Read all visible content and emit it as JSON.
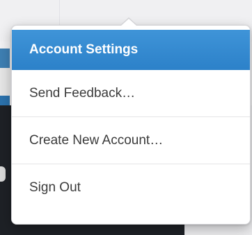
{
  "menu": {
    "items": [
      {
        "label": "Account Settings",
        "active": true
      },
      {
        "label": "Send Feedback…",
        "active": false
      },
      {
        "label": "Create New Account…",
        "active": false
      },
      {
        "label": "Sign Out",
        "active": false
      }
    ]
  },
  "colors": {
    "highlight": "#2f86cf",
    "popover_bg": "#ffffff",
    "text": "#3b3b3b"
  }
}
